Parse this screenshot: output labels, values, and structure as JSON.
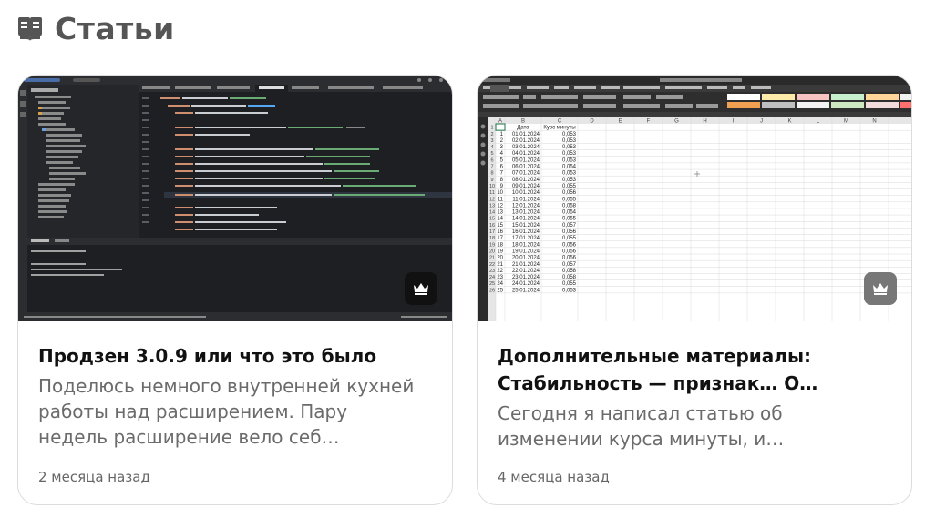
{
  "section": {
    "title": "Статьи",
    "icon": "book-icon"
  },
  "articles": [
    {
      "title": "Продзен 3.0.9 или что это было",
      "description": "Поделюсь немного внутренней кухней работы над расширением. Пару недель расширение вело себ…",
      "date": "2 месяца назад",
      "thumbnail": "ide-code-screenshot",
      "badge_icon": "crown-icon",
      "badge_color": "#111111"
    },
    {
      "title": "Дополнительные материалы: Стабильность — признак… О…",
      "description": "Сегодня я написал статью об изменении курса минуты, и…",
      "date": "4 месяца назад",
      "thumbnail": "spreadsheet-screenshot",
      "badge_icon": "crown-icon",
      "badge_color": "#777777",
      "sheet": {
        "columns": [
          "A",
          "B",
          "C",
          "D",
          "E",
          "F",
          "G",
          "H",
          "I",
          "J",
          "K",
          "L",
          "M",
          "N"
        ],
        "header": [
          "Дата",
          "Курс минуты"
        ],
        "rows": [
          [
            "1",
            "01.01.2024",
            "0,053"
          ],
          [
            "2",
            "02.01.2024",
            "0,053"
          ],
          [
            "3",
            "03.01.2024",
            "0,053"
          ],
          [
            "4",
            "04.01.2024",
            "0,053"
          ],
          [
            "5",
            "05.01.2024",
            "0,053"
          ],
          [
            "6",
            "06.01.2024",
            "0,054"
          ],
          [
            "7",
            "07.01.2024",
            "0,053"
          ],
          [
            "8",
            "08.01.2024",
            "0,053"
          ],
          [
            "9",
            "09.01.2024",
            "0,055"
          ],
          [
            "10",
            "10.01.2024",
            "0,056"
          ],
          [
            "11",
            "11.01.2024",
            "0,055"
          ],
          [
            "12",
            "12.01.2024",
            "0,058"
          ],
          [
            "13",
            "13.01.2024",
            "0,054"
          ],
          [
            "14",
            "14.01.2024",
            "0,055"
          ],
          [
            "15",
            "15.01.2024",
            "0,057"
          ],
          [
            "16",
            "16.01.2024",
            "0,056"
          ],
          [
            "17",
            "17.01.2024",
            "0,055"
          ],
          [
            "18",
            "18.01.2024",
            "0,056"
          ],
          [
            "19",
            "19.01.2024",
            "0,056"
          ],
          [
            "20",
            "20.01.2024",
            "0,056"
          ],
          [
            "21",
            "21.01.2024",
            "0,057"
          ],
          [
            "22",
            "22.01.2024",
            "0,058"
          ],
          [
            "23",
            "23.01.2024",
            "0,058"
          ],
          [
            "24",
            "24.01.2024",
            "0,055"
          ],
          [
            "25",
            "25.01.2024",
            "0,053"
          ]
        ]
      }
    }
  ]
}
